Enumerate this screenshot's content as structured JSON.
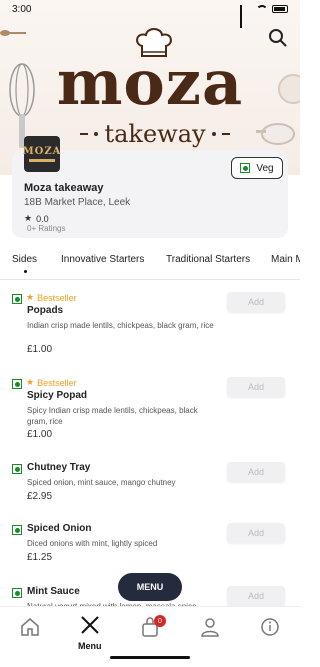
{
  "status_bar": {
    "time": "3:00"
  },
  "brand": {
    "title": "moza",
    "subtitle": "takeway"
  },
  "restaurant": {
    "name": "Moza takeaway",
    "address": "18B Market Place, Leek",
    "rating": "0.0",
    "ratings_count": "0+ Ratings",
    "veg_toggle_label": "Veg",
    "logo_text": "MOZA"
  },
  "tabs": [
    "Sides",
    "Innovative Starters",
    "Traditional Starters",
    "Main Menu"
  ],
  "bestseller_label": "Bestseller",
  "add_label": "Add",
  "items": [
    {
      "name": "Popads",
      "desc": "Indian crisp made lentils, chickpeas, black gram, rice",
      "price": "£1.00",
      "bestseller": true
    },
    {
      "name": "Spicy Popad",
      "desc": "Spicy Indian crisp made lentils, chickpeas, black gram, rice",
      "price": "£1.00",
      "bestseller": true
    },
    {
      "name": "Chutney Tray",
      "desc": "Spiced onion, mint sauce, mango chutney",
      "price": "£2.95",
      "bestseller": false
    },
    {
      "name": "Spiced Onion",
      "desc": "Diced onions with mint, lightly spiced",
      "price": "£1.25",
      "bestseller": false
    },
    {
      "name": "Mint Sauce",
      "desc": "Natural yogurt mixed with lemon, massala spice",
      "price": "",
      "bestseller": false
    }
  ],
  "menu_button": "MENU",
  "bottom_nav": {
    "menu_label": "Menu",
    "cart_count": "0"
  },
  "colors": {
    "accent_brown": "#4a2a17",
    "veg_green": "#1b8a2a",
    "bestseller": "#f0a020",
    "fab": "#242b3d",
    "badge": "#d42828"
  }
}
